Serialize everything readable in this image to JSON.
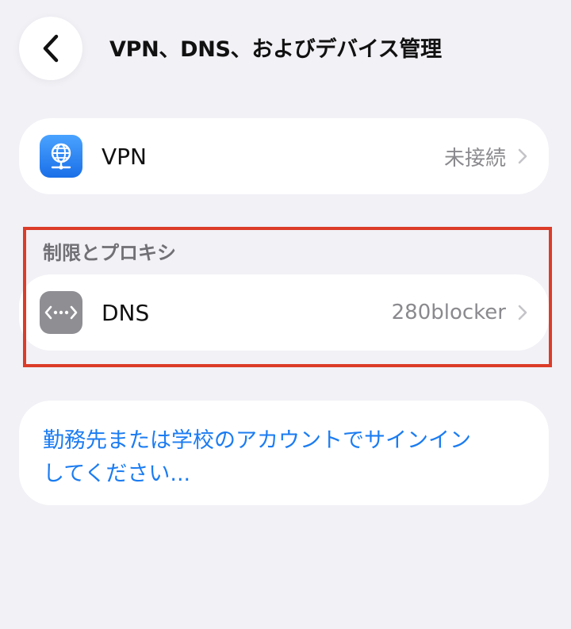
{
  "header": {
    "title": "VPN、DNS、およびデバイス管理"
  },
  "vpn_row": {
    "label": "VPN",
    "value": "未接続",
    "icon": "globe-network-icon"
  },
  "section": {
    "header": "制限とプロキシ"
  },
  "dns_row": {
    "label": "DNS",
    "value": "280blocker",
    "icon": "dns-arrows-icon"
  },
  "signin": {
    "line1": "勤務先または学校のアカウントでサインイン",
    "line2": "してください..."
  },
  "colors": {
    "background": "#f1f1f6",
    "card": "#ffffff",
    "link": "#1b7cf2",
    "secondary_text": "#8a8a8e",
    "highlight": "#dc3c28",
    "vpn_icon": "#2f8af5",
    "dns_icon": "#8e8e93"
  }
}
